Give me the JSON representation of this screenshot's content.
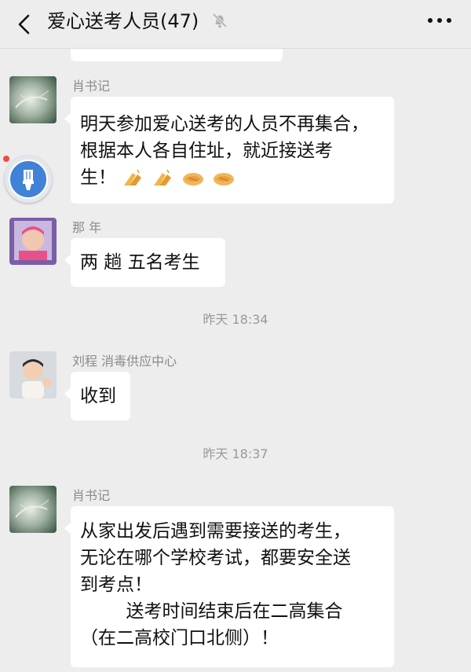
{
  "header": {
    "title": "爱心送考人员(47)",
    "back_icon": "chevron-left-icon",
    "mute_icon": "bell-muted-icon",
    "more_icon": "more-dots-icon"
  },
  "floating_button": {
    "icon": "brush-icon"
  },
  "messages": [
    {
      "sender": "肖书记",
      "lines": [
        "明天参加爱心送考的人员不再集合，",
        "根据本人各自住址，就近接送考",
        "生！"
      ],
      "emoji": [
        "clapping-hands-emoji",
        "clapping-hands-emoji",
        "handshake-emoji",
        "handshake-emoji"
      ]
    },
    {
      "sender": "那 年",
      "lines": [
        "两 趟  五名考生"
      ]
    },
    {
      "sender": "刘程 消毒供应中心",
      "lines": [
        "收到"
      ]
    },
    {
      "sender": "肖书记",
      "lines": [
        "从家出发后遇到需要接送的考生，",
        "无论在哪个学校考试，都要安全送",
        "到考点！",
        "        送考时间结束后在二高集合",
        "（在二高校门口北侧）！"
      ]
    }
  ],
  "timestamps": [
    "昨天 18:34",
    "昨天 18:37"
  ]
}
